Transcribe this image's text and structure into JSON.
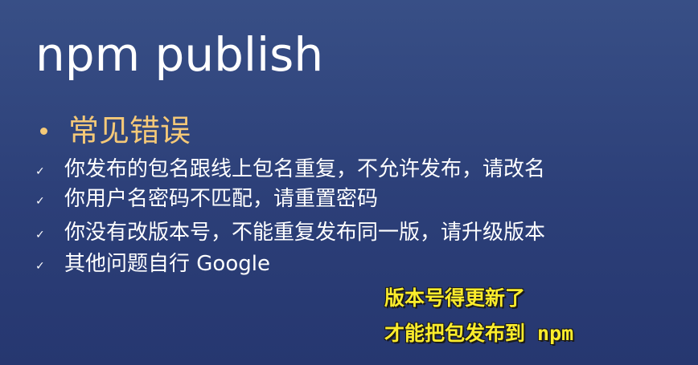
{
  "slide": {
    "title": "npm publish",
    "section": {
      "heading": "常见错误",
      "bullet_color": "#f5c978"
    },
    "check_glyph": "✓",
    "items": [
      {
        "text": "你发布的包名跟线上包名重复，不允许发布，请改名"
      },
      {
        "text": "你用户名密码不匹配，请重置密码"
      },
      {
        "text": "你没有改版本号，不能重复发布同一版，请升级版本"
      },
      {
        "text": "其他问题自行 Google"
      }
    ],
    "annotation": {
      "lines": [
        "版本号得更新了",
        "才能把包发布到 npm"
      ],
      "color": "#fbec2c"
    }
  },
  "colors": {
    "background": "#2e4178",
    "text": "#ffffff"
  }
}
